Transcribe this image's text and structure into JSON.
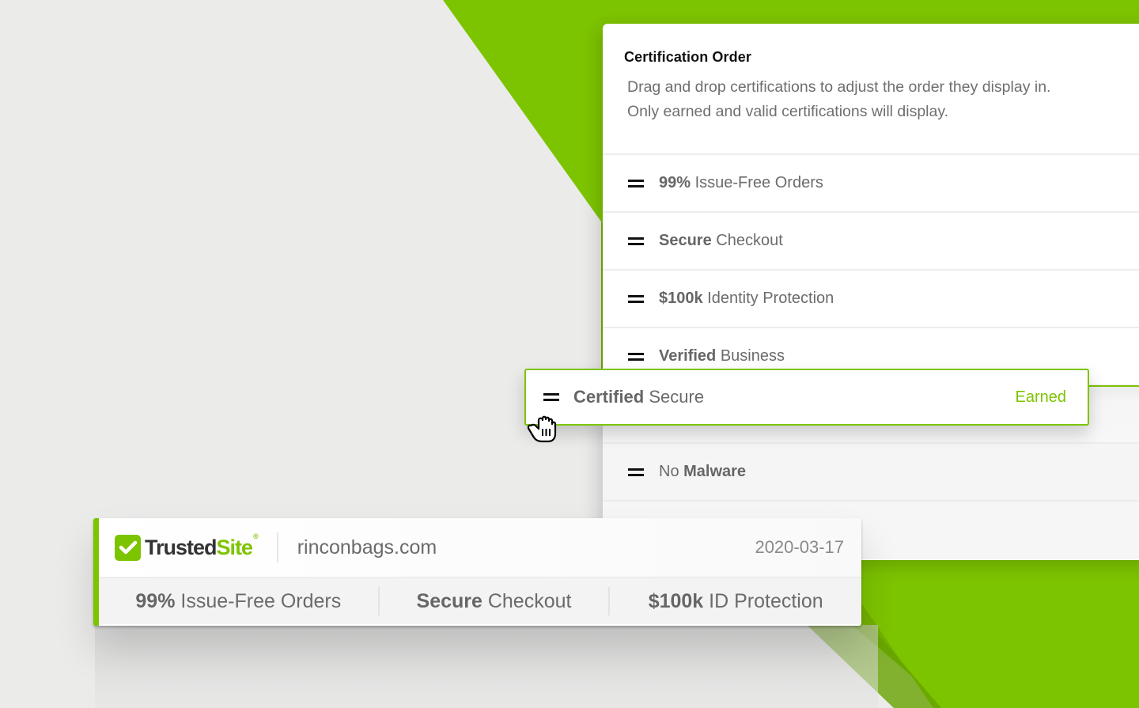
{
  "colors": {
    "accent": "#7dc400",
    "accent_dark": "#72b000",
    "background": "#ebebea"
  },
  "panel": {
    "title": "Certification Order",
    "description_line1": "Drag and drop certifications to adjust the order they display in.",
    "description_line2": "Only earned and valid certifications will display.",
    "items": [
      {
        "bold": "99%",
        "rest": " Issue-Free Orders"
      },
      {
        "bold": "Secure",
        "rest": " Checkout"
      },
      {
        "bold": "$100k",
        "rest": " Identity Protection"
      },
      {
        "bold": "Verified",
        "rest": " Business"
      },
      {
        "pre": "No ",
        "bold": "Malware"
      }
    ]
  },
  "dragged_item": {
    "bold": "Certified",
    "rest": " Secure",
    "status": "Earned",
    "icon": "drag-handle-icon"
  },
  "cursor": {
    "icon": "grabbing-hand-icon"
  },
  "badge": {
    "brand_trusted": "Trusted",
    "brand_site": "Site",
    "brand_reg": "®",
    "domain": "rinconbags.com",
    "date": "2020-03-17",
    "certs": [
      {
        "bold": "99%",
        "rest": " Issue-Free Orders"
      },
      {
        "bold": "Secure",
        "rest": " Checkout"
      },
      {
        "bold": "$100k",
        "rest": " ID Protection"
      }
    ]
  }
}
